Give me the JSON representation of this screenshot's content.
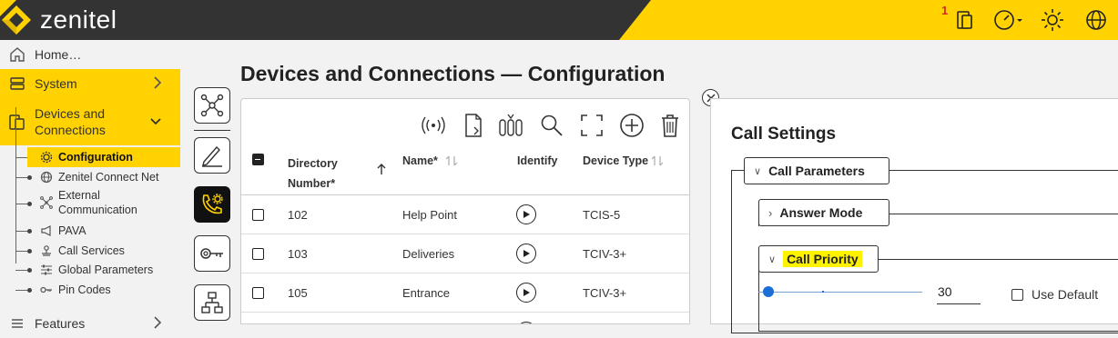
{
  "app": {
    "logo_text": "zenitel",
    "notification_count": "1"
  },
  "colors": {
    "accent": "#ffd200",
    "dark": "#333333",
    "link": "#1c6fd6",
    "highlight": "#fff200"
  },
  "topbar": {
    "icons": [
      "device-alert-icon",
      "gauge-icon",
      "brightness-icon",
      "globe-icon"
    ]
  },
  "sidebar": {
    "home": "Home…",
    "system": "System",
    "devices": "Devices and Connections",
    "sub_items": [
      "Configuration",
      "Zenitel Connect Net",
      "External Communication",
      "PAVA",
      "Call Services",
      "Global Parameters",
      "Pin Codes"
    ],
    "features": "Features"
  },
  "main": {
    "title": "Devices and Connections — Configuration"
  },
  "table": {
    "headers": {
      "directory_number": "Directory Number*",
      "name": "Name*",
      "identify": "Identify",
      "device_type": "Device Type"
    },
    "rows": [
      {
        "number": "102",
        "name": "Help Point",
        "type": "TCIS-5"
      },
      {
        "number": "103",
        "name": "Deliveries",
        "type": "TCIV-3+"
      },
      {
        "number": "105",
        "name": "Entrance",
        "type": "TCIV-3+"
      }
    ]
  },
  "settings": {
    "title": "Call Settings",
    "groups": {
      "call_parameters": "Call Parameters",
      "answer_mode": "Answer Mode",
      "call_priority": "Call Priority"
    },
    "priority_value": "30",
    "priority_fraction": 0.06,
    "use_default": "Use Default"
  }
}
